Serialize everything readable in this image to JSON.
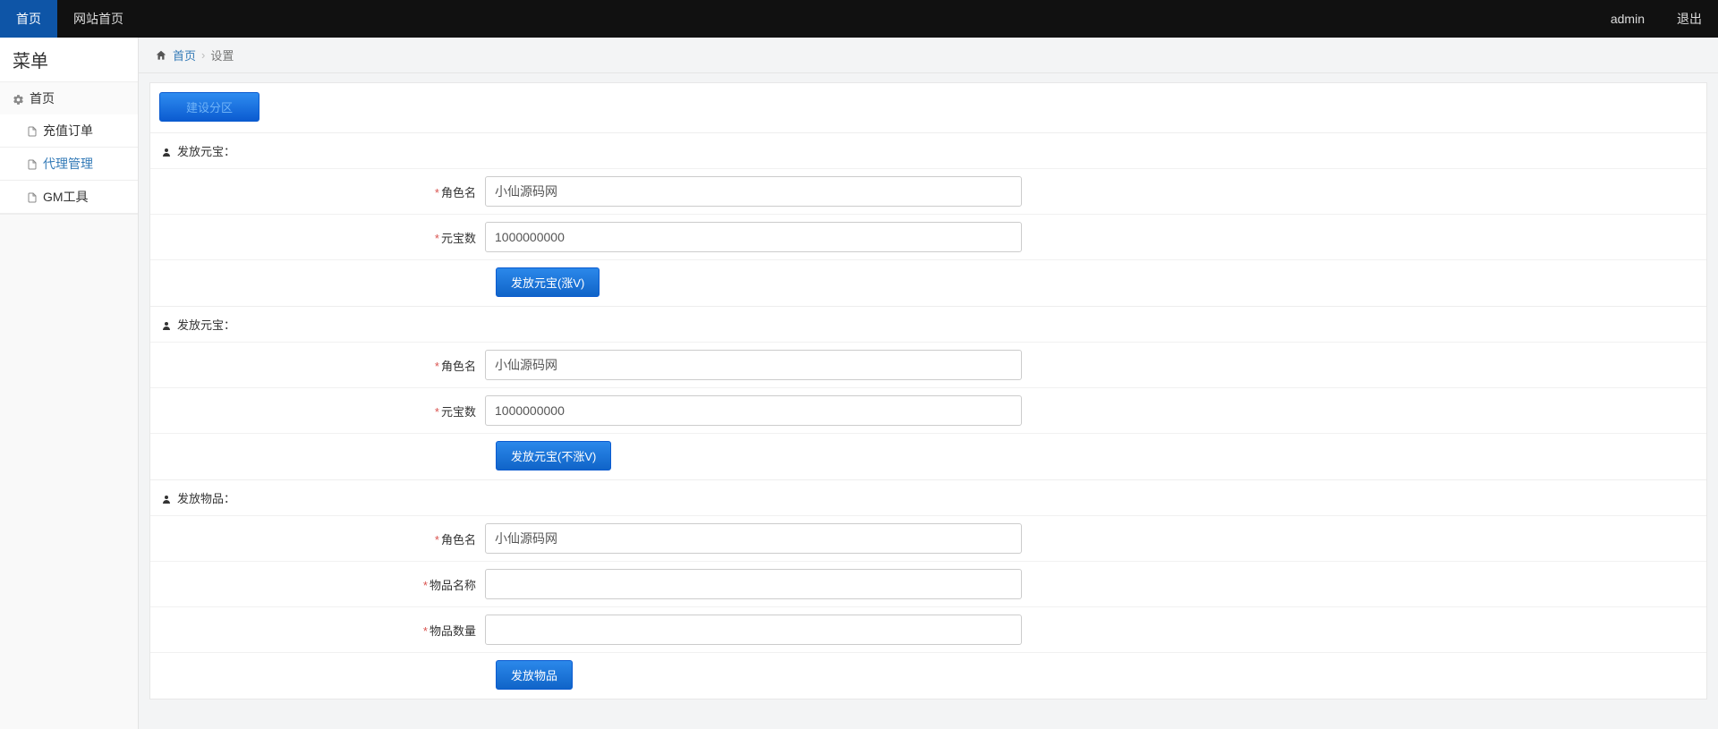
{
  "navbar": {
    "left": [
      {
        "label": "首页",
        "active": true
      },
      {
        "label": "网站首页",
        "active": false
      }
    ],
    "right": [
      {
        "label": "admin"
      },
      {
        "label": "退出"
      }
    ]
  },
  "sidebar": {
    "title": "菜单",
    "root": {
      "label": "首页"
    },
    "items": [
      {
        "label": "充值订单",
        "active": false
      },
      {
        "label": "代理管理",
        "active": true
      },
      {
        "label": "GM工具",
        "active": false
      }
    ]
  },
  "breadcrumb": {
    "home_link": "首页",
    "current": "设置",
    "separator": "›"
  },
  "top_button": "建设分区",
  "panels": [
    {
      "title": "发放元宝：",
      "fields": [
        {
          "label": "角色名",
          "value": "小仙源码网"
        },
        {
          "label": "元宝数",
          "value": "1000000000"
        }
      ],
      "button": "发放元宝(涨V)"
    },
    {
      "title": "发放元宝：",
      "fields": [
        {
          "label": "角色名",
          "value": "小仙源码网"
        },
        {
          "label": "元宝数",
          "value": "1000000000"
        }
      ],
      "button": "发放元宝(不涨V)"
    },
    {
      "title": "发放物品：",
      "fields": [
        {
          "label": "角色名",
          "value": "小仙源码网"
        },
        {
          "label": "物品名称",
          "value": ""
        },
        {
          "label": "物品数量",
          "value": ""
        }
      ],
      "button": "发放物品"
    }
  ]
}
